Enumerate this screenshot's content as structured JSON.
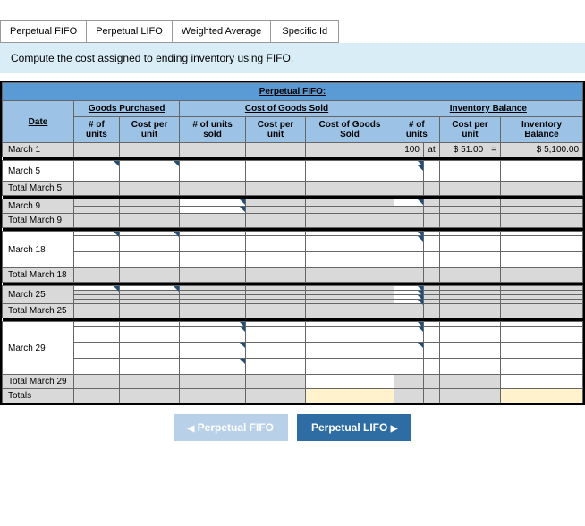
{
  "tabs": {
    "t1": "Perpetual FIFO",
    "t2": "Perpetual LIFO",
    "t3": "Weighted Average",
    "t4": "Specific Id"
  },
  "instruction": "Compute the cost assigned to ending inventory using FIFO.",
  "table": {
    "title": "Perpetual FIFO:",
    "groups": {
      "date": "Date",
      "purchased": "Goods Purchased",
      "cogs": "Cost of Goods Sold",
      "balance": "Inventory Balance"
    },
    "cols": {
      "p_units": "# of units",
      "p_cost": "Cost per unit",
      "s_units": "# of units sold",
      "s_cost": "Cost per unit",
      "s_total": "Cost of Goods Sold",
      "b_units": "# of units",
      "b_cost": "Cost per unit",
      "b_total": "Inventory Balance"
    },
    "rows": {
      "m1": "March 1",
      "m5": "March 5",
      "tm5": "Total March 5",
      "m9": "March 9",
      "tm9": "Total March 9",
      "m18": "March 18",
      "tm18": "Total March 18",
      "m25": "March 25",
      "tm25": "Total March 25",
      "m29": "March 29",
      "tm29": "Total March 29",
      "totals": "Totals"
    },
    "m1_data": {
      "units": "100",
      "at": "at",
      "cost": "$ 51.00",
      "eq": "=",
      "bal": "$  5,100.00"
    }
  },
  "nav": {
    "prev": "Perpetual FIFO",
    "next": "Perpetual LIFO"
  }
}
